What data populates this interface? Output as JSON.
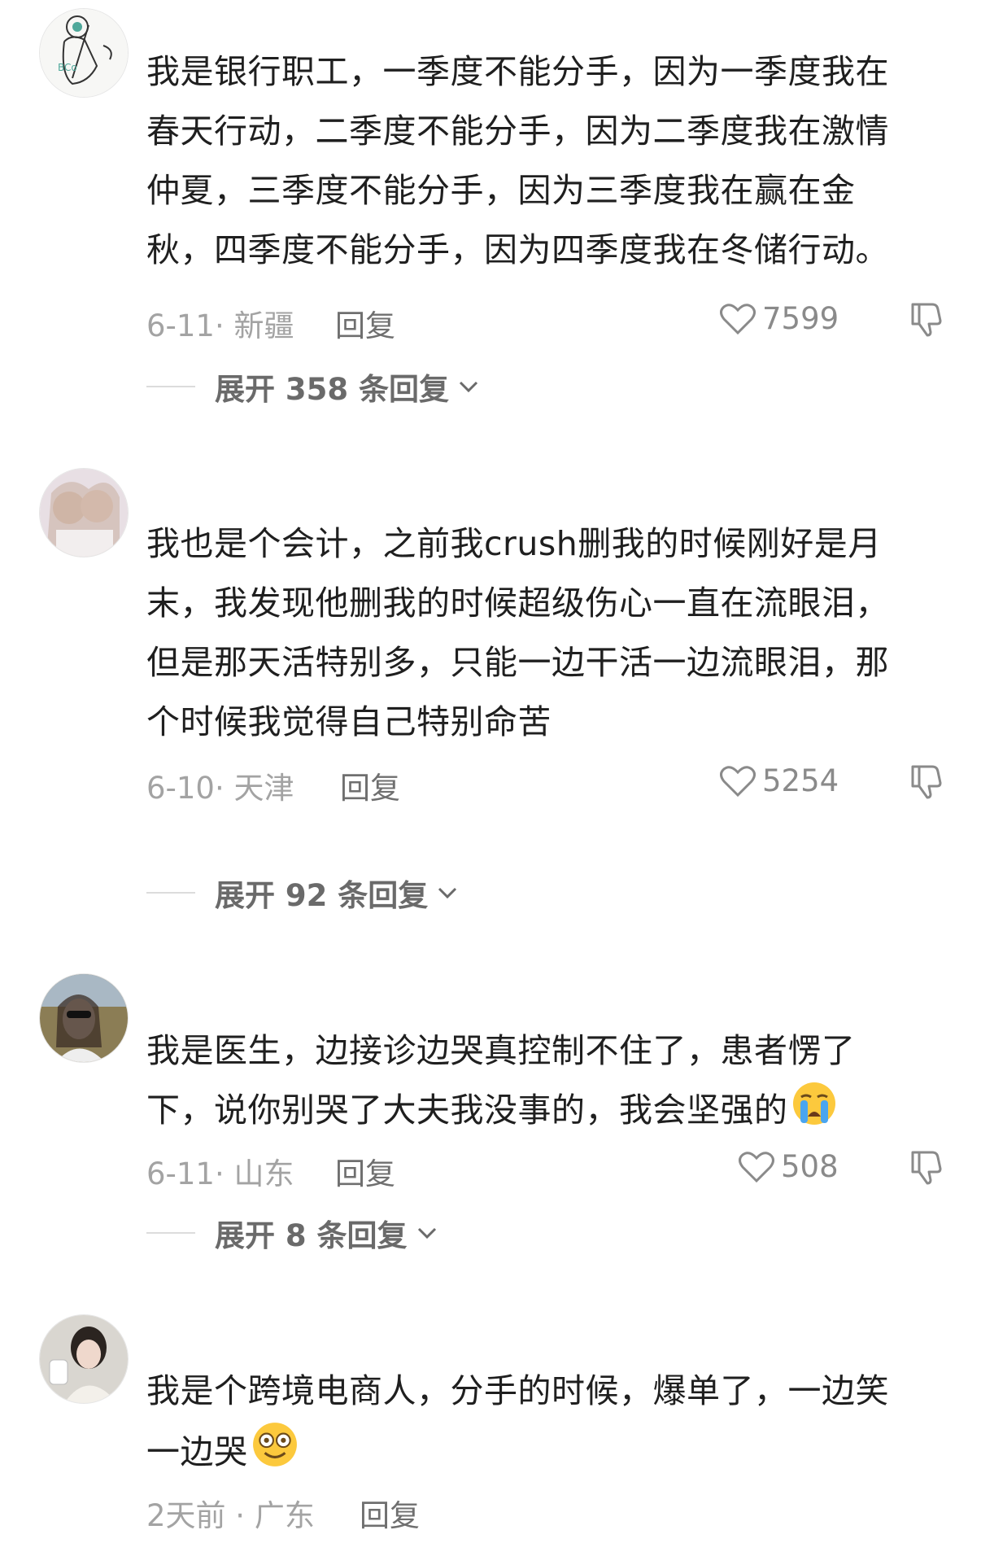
{
  "comments": [
    {
      "lines": [
        "我是银行职工，一季度不能分手，因为一季度我在",
        "春天行动，二季度不能分手，因为二季度我在激情",
        "仲夏，三季度不能分手，因为三季度我在赢在金",
        "秋，四季度不能分手，因为四季度我在冬储行动。"
      ],
      "date": "6-11· 新疆",
      "reply": "回复",
      "likes": "7599",
      "expand": "展开 358 条回复"
    },
    {
      "lines": [
        "我也是个会计，之前我crush删我的时候刚好是月",
        "末，我发现他删我的时候超级伤心一直在流眼泪，",
        "但是那天活特别多，只能一边干活一边流眼泪，那",
        "个时候我觉得自己特别命苦"
      ],
      "date": "6-10· 天津",
      "reply": "回复",
      "likes": "5254",
      "expand": "展开 92 条回复"
    },
    {
      "lines": [
        "我是医生，边接诊边哭真控制不住了，患者愣了",
        "下，说你别哭了大夫我没事的，我会坚强的"
      ],
      "date": "6-11· 山东",
      "reply": "回复",
      "likes": "508",
      "expand": "展开 8 条回复"
    },
    {
      "lines": [
        "我是个跨境电商人，分手的时候，爆单了，一边笑",
        "一边哭"
      ],
      "date": "2天前 · 广东",
      "reply": "回复"
    }
  ],
  "icons": {
    "like": "heart-outline-icon",
    "dislike": "thumbs-down-icon",
    "chevron": "chevron-down-icon",
    "emoji_crying": "loudly-crying-face-emoji",
    "emoji_dizzy": "dizzy-smile-face-emoji"
  },
  "colors": {
    "text": "#1f1f1f",
    "meta": "#a3a3a3",
    "expand": "#6a6a6a"
  }
}
